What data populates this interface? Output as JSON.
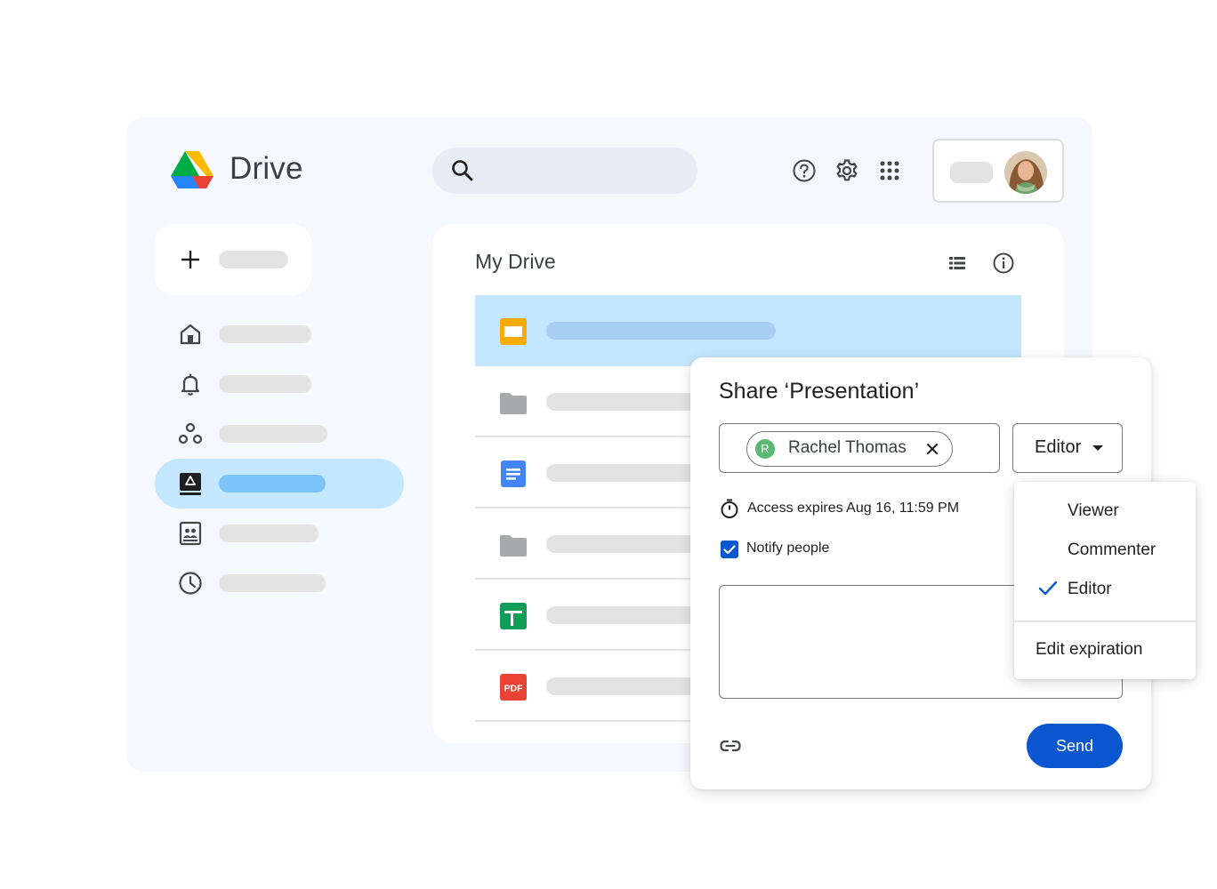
{
  "app": {
    "title": "Drive"
  },
  "main": {
    "title": "My Drive",
    "files": [
      {
        "icon": "slides-icon",
        "selected": true
      },
      {
        "icon": "folder-icon",
        "selected": false
      },
      {
        "icon": "docs-icon",
        "selected": false
      },
      {
        "icon": "folder-icon",
        "selected": false
      },
      {
        "icon": "sheets-icon",
        "selected": false
      },
      {
        "icon": "pdf-icon",
        "selected": false,
        "badge": "PDF"
      }
    ]
  },
  "share_dialog": {
    "title": "Share ‘Presentation’",
    "recipient": {
      "initial": "R",
      "name": "Rachel Thomas"
    },
    "role": "Editor",
    "expiration": "Access expires Aug 16, 11:59 PM",
    "notify_label": "Notify people",
    "notify_checked": true,
    "send_label": "Send"
  },
  "role_menu": {
    "items": [
      "Viewer",
      "Commenter",
      "Editor"
    ],
    "selected": "Editor",
    "extra": "Edit expiration"
  },
  "colors": {
    "accent": "#0b57d0",
    "selection": "#c2e7ff",
    "slides": "#f9ab00",
    "docs": "#4285f4",
    "sheets": "#0f9d58",
    "pdf": "#ea4335"
  }
}
